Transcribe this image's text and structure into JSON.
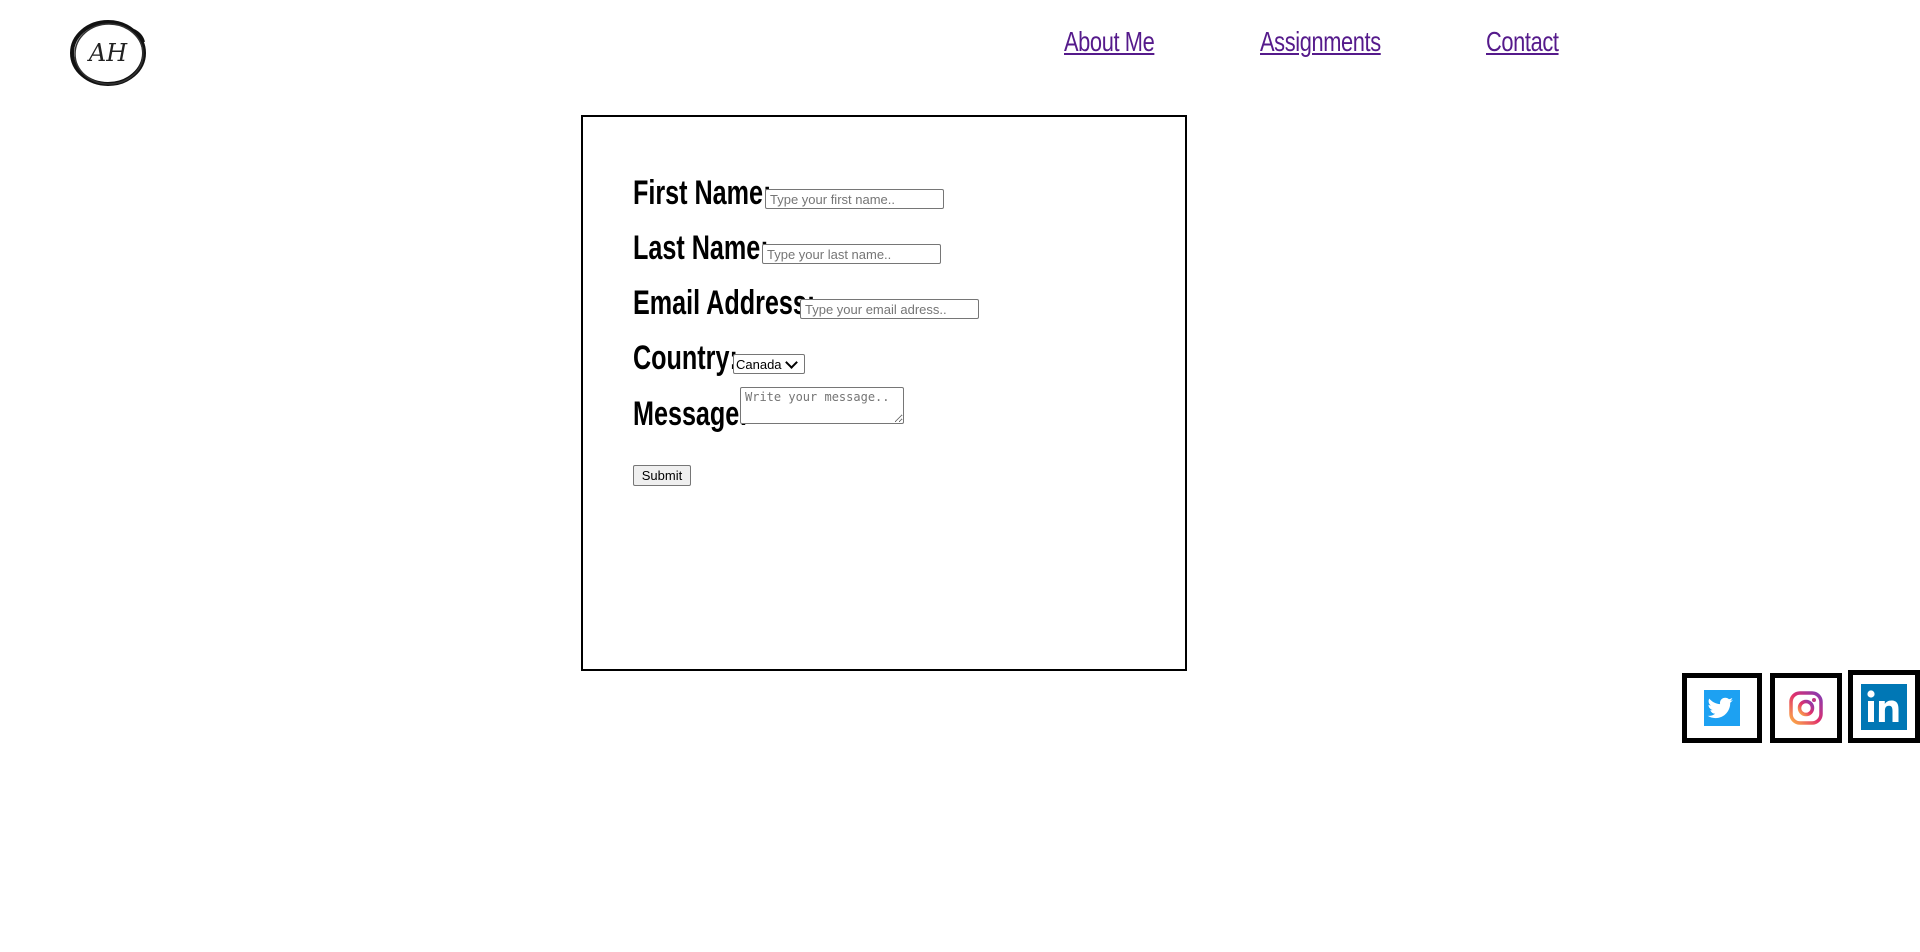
{
  "logo": {
    "text": "AH"
  },
  "nav": {
    "items": [
      {
        "label": "About Me"
      },
      {
        "label": "Assignments"
      },
      {
        "label": "Contact"
      }
    ],
    "link_color": "#551a8b"
  },
  "form": {
    "first_name": {
      "label": "First Name:",
      "placeholder": "Type your first name.."
    },
    "last_name": {
      "label": "Last Name:",
      "placeholder": "Type your last name.."
    },
    "email": {
      "label": "Email Address:",
      "placeholder": "Type your email adress.."
    },
    "country": {
      "label": "Country:",
      "selected": "Canada"
    },
    "message": {
      "label": "Message:",
      "placeholder": "Write your message.."
    },
    "submit_label": "Submit"
  },
  "social": {
    "items": [
      {
        "icon": "twitter-icon",
        "color": "#1da1f2"
      },
      {
        "icon": "instagram-icon",
        "color": "#e1306c"
      },
      {
        "icon": "linkedin-icon",
        "color": "#0077b5"
      }
    ]
  }
}
